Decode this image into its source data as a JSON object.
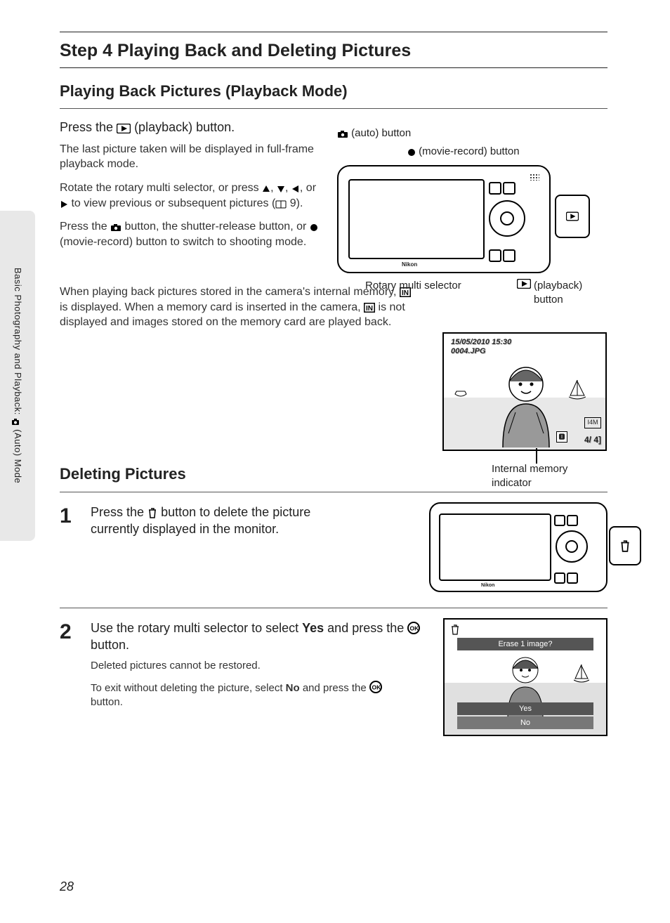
{
  "title": "Step 4 Playing Back and Deleting Pictures",
  "section1": "Playing Back Pictures (Playback Mode)",
  "action": {
    "pre": "Press the ",
    "post": " (playback) button."
  },
  "p1": "The last picture taken will be displayed in full-frame playback mode.",
  "p2a": "Rotate the rotary multi selector, or press ",
  "p2b": ", or ",
  "p2c": " to view previous or subsequent pictures (",
  "p2d": " 9).",
  "p3a": "Press the ",
  "p3b": " button, the shutter-release button, or ",
  "p3c": " (movie-record) button to switch to shooting mode.",
  "p4a": "When playing back pictures stored in the camera's internal memory, ",
  "p4b": " is displayed. When a memory card is inserted in the camera, ",
  "p4c": " is not displayed and images stored on the memory card are played back.",
  "labels": {
    "auto": " (auto) button",
    "movie": " (movie-record) button",
    "rotary": "Rotary multi selector",
    "playback": " (playback) button",
    "internal": "Internal memory indicator"
  },
  "lcd": {
    "date": "15/05/2010 15:30",
    "file": "0004.JPG",
    "badge": "I4M",
    "count": "4/    4]",
    "im": "🅸"
  },
  "camera_brand": "Nikon",
  "section2": "Deleting Pictures",
  "step1": {
    "num": "1",
    "text_a": "Press the ",
    "text_b": " button to delete the picture currently displayed in the monitor."
  },
  "step2": {
    "num": "2",
    "lead_a": "Use the rotary multi selector to select ",
    "lead_yes": "Yes",
    "lead_b": " and press the ",
    "lead_c": " button.",
    "sub1": "Deleted pictures cannot be restored.",
    "sub2a": "To exit without deleting the picture, select ",
    "sub2_no": "No",
    "sub2b": " and press the ",
    "sub2c": " button."
  },
  "erase": {
    "title": "Erase 1 image?",
    "yes": "Yes",
    "no": "No"
  },
  "sidetab_a": "Basic Photography and Playback: ",
  "sidetab_b": " (Auto) Mode",
  "pagenum": "28"
}
